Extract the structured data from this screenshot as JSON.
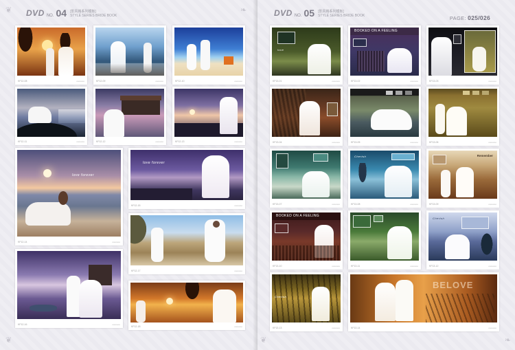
{
  "left_page": {
    "header": {
      "dvd": "DVD",
      "no_label": "NO.",
      "number": "04",
      "subtitle_cn": "[影风格系列模板]",
      "subtitle_en": "STYLE SERIES BRIDE BOOK"
    },
    "cards": [
      {
        "code": "KF12-08",
        "tag": "ooooooo"
      },
      {
        "code": "KF12-09",
        "tag": "ooooooo"
      },
      {
        "code": "KF12-10",
        "tag": "ooooooo"
      },
      {
        "code": "KF12-11",
        "tag": "ooooooo"
      },
      {
        "code": "KF12-12",
        "tag": "ooooooo"
      },
      {
        "code": "KF12-13",
        "tag": "ooooooo"
      },
      {
        "code": "KF12-14",
        "tag": "ooooooo"
      },
      {
        "code": "KF12-15",
        "tag": "ooooooo"
      },
      {
        "code": "KF12-16",
        "tag": "ooooooo"
      },
      {
        "code": "KF12-17",
        "tag": "ooooooo"
      },
      {
        "code": "KF12-18",
        "tag": "ooooooo"
      }
    ]
  },
  "right_page": {
    "header": {
      "dvd": "DVD",
      "no_label": "NO.",
      "number": "05",
      "subtitle_cn": "[影风格系列模板]",
      "subtitle_en": "STYLE SERIES BRIDE BOOK"
    },
    "page_label": "PAGE: ",
    "page_number": "025/026",
    "cards": [
      {
        "code": "KF13-01",
        "tag": "ooooooo"
      },
      {
        "code": "KF13-02",
        "tag": "ooooooo"
      },
      {
        "code": "KF13-03",
        "tag": "ooooooo"
      },
      {
        "code": "KF13-04",
        "tag": "ooooooo"
      },
      {
        "code": "KF13-05",
        "tag": "ooooooo"
      },
      {
        "code": "KF13-06",
        "tag": "ooooooo"
      },
      {
        "code": "KF13-07",
        "tag": "ooooooo"
      },
      {
        "code": "KF13-08",
        "tag": "ooooooo"
      },
      {
        "code": "KF13-09",
        "tag": "ooooooo"
      },
      {
        "code": "KF13-10",
        "tag": "ooooooo"
      },
      {
        "code": "KF13-11",
        "tag": "ooooooo"
      },
      {
        "code": "KF13-12",
        "tag": "ooooooo"
      },
      {
        "code": "KF13-13",
        "tag": "ooooooo"
      },
      {
        "code": "KF13-14",
        "tag": "ooooooo"
      }
    ],
    "overlay_texts": {
      "booked": "BOOKED ON A FEELING",
      "booked2": "BOOKED ON A FEELING",
      "remember": "Remember",
      "cherish": "Cherish",
      "believe": "BELOVE",
      "love_script": "love forever"
    }
  },
  "colors": {
    "page_bg": "#eeedf2",
    "card_bg": "#ffffff",
    "header_text": "#8d8b96"
  }
}
